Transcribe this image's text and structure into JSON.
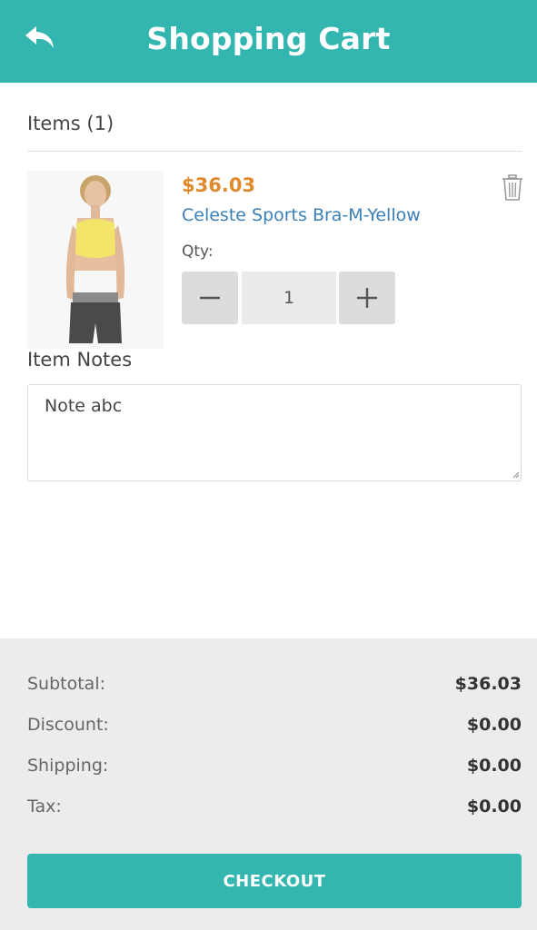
{
  "header": {
    "title": "Shopping Cart",
    "back_icon": "reply-arrow-icon",
    "bg_color": "#34b6b0"
  },
  "cart": {
    "items_label": "Items (1)",
    "items": [
      {
        "price": "$36.03",
        "name": "Celeste Sports Bra-M-Yellow",
        "qty_label": "Qty:",
        "qty": "1",
        "price_color": "#e0892d",
        "name_color": "#3a7fb8",
        "delete_icon": "trash-icon",
        "decrement_icon": "minus-icon",
        "increment_icon": "plus-icon"
      }
    ],
    "notes_label": "Item Notes",
    "notes_value": "Note abc"
  },
  "summary": {
    "rows": [
      {
        "label": "Subtotal:",
        "value": "$36.03"
      },
      {
        "label": "Discount:",
        "value": "$0.00"
      },
      {
        "label": "Shipping:",
        "value": "$0.00"
      },
      {
        "label": "Tax:",
        "value": "$0.00"
      }
    ],
    "checkout_label": "CHECKOUT"
  }
}
